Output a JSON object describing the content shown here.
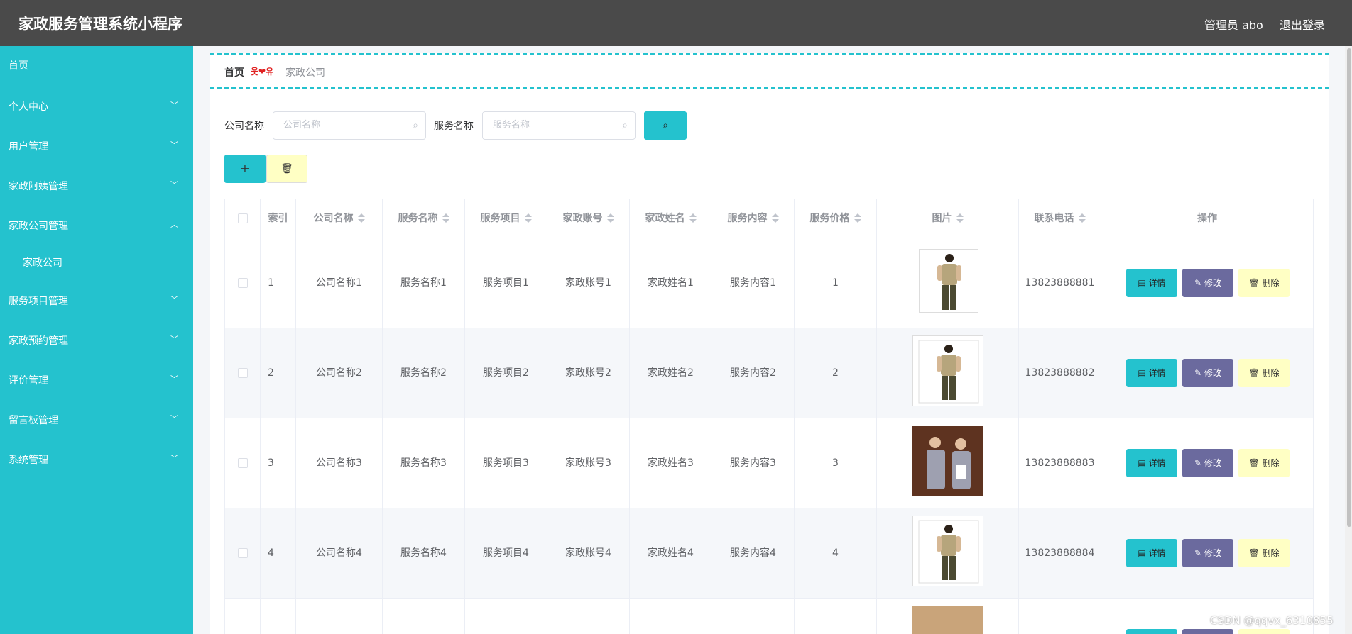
{
  "app": {
    "title": "家政服务管理系统小程序",
    "admin": "管理员 abo",
    "logout": "退出登录"
  },
  "sidebar": {
    "items": [
      {
        "label": "首页"
      },
      {
        "label": "个人中心",
        "chevron": "﹀"
      },
      {
        "label": "用户管理",
        "chevron": "﹀"
      },
      {
        "label": "家政阿姨管理",
        "chevron": "﹀"
      },
      {
        "label": "家政公司管理",
        "chevron": "︿"
      },
      {
        "label": "家政公司"
      },
      {
        "label": "服务项目管理",
        "chevron": "﹀"
      },
      {
        "label": "家政预约管理",
        "chevron": "﹀"
      },
      {
        "label": "评价管理",
        "chevron": "﹀"
      },
      {
        "label": "留言板管理",
        "chevron": "﹀"
      },
      {
        "label": "系统管理",
        "chevron": "﹀"
      }
    ]
  },
  "breadcrumb": {
    "home": "首页",
    "separator": "웃❤유",
    "current": "家政公司"
  },
  "search": {
    "company_label": "公司名称",
    "company_placeholder": "公司名称",
    "service_label": "服务名称",
    "service_placeholder": "服务名称",
    "search_icon": "⌕"
  },
  "toolbar": {
    "add_label": "+",
    "delete_label": "🗑"
  },
  "table": {
    "headers": [
      "索引",
      "公司名称",
      "服务名称",
      "服务项目",
      "家政账号",
      "家政姓名",
      "服务内容",
      "服务价格",
      "图片",
      "联系电话",
      "操作"
    ],
    "rows": [
      {
        "index": "1",
        "company": "公司名称1",
        "service": "服务名称1",
        "project": "服务项目1",
        "account": "家政账号1",
        "name": "家政姓名1",
        "content": "服务内容1",
        "price": "1",
        "phone": "13823888881"
      },
      {
        "index": "2",
        "company": "公司名称2",
        "service": "服务名称2",
        "project": "服务项目2",
        "account": "家政账号2",
        "name": "家政姓名2",
        "content": "服务内容2",
        "price": "2",
        "phone": "13823888882"
      },
      {
        "index": "3",
        "company": "公司名称3",
        "service": "服务名称3",
        "project": "服务项目3",
        "account": "家政账号3",
        "name": "家政姓名3",
        "content": "服务内容3",
        "price": "3",
        "phone": "13823888883"
      },
      {
        "index": "4",
        "company": "公司名称4",
        "service": "服务名称4",
        "project": "服务项目4",
        "account": "家政账号4",
        "name": "家政姓名4",
        "content": "服务内容4",
        "price": "4",
        "phone": "13823888884"
      }
    ],
    "actions": {
      "detail": "详情",
      "edit": "修改",
      "remove": "删除"
    }
  },
  "watermark": "CSDN @qqvx_6310855",
  "colors": {
    "accent": "#24c2ce",
    "topbar": "#4a4a4a",
    "edit": "#6b6a9e",
    "delete": "#ffffc4"
  }
}
